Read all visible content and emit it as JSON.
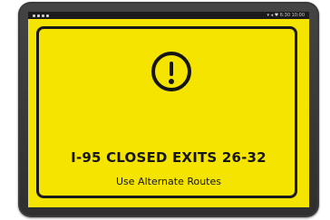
{
  "device": {
    "status_bar": {
      "right_text": "▾ ◂ ♥ 6:30 10:00"
    }
  },
  "sign": {
    "icon": "exclamation-circle-icon",
    "headline": "I-95 CLOSED EXITS 26-32",
    "subline": "Use Alternate Routes"
  },
  "colors": {
    "screen_background": "#f5e400",
    "ink": "#151515",
    "bezel": "#3a3a3a"
  }
}
